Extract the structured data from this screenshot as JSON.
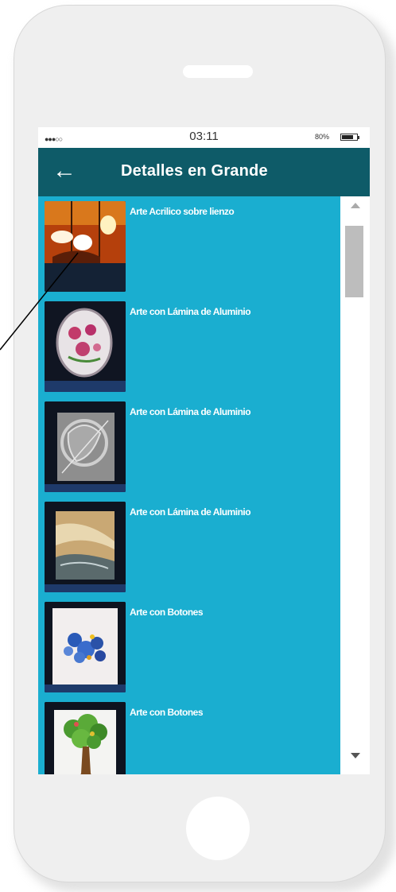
{
  "status_bar": {
    "signal": "●●●○○",
    "time": "03:11",
    "battery_percent": "80%",
    "battery_level": 0.8
  },
  "app_bar": {
    "back_icon": "arrow-left-icon",
    "title": "Detalles en Grande"
  },
  "items": [
    {
      "label": "Arte Acrilico sobre lienzo",
      "image": "painting-flowers"
    },
    {
      "label": "Arte con Lámina de Aluminio",
      "image": "aluminum-oval-flowers"
    },
    {
      "label": "Arte con Lámina de Aluminio",
      "image": "aluminum-silver-relief"
    },
    {
      "label": "Arte con Lámina de Aluminio",
      "image": "aluminum-gold-landscape"
    },
    {
      "label": "Arte con Botones",
      "image": "buttons-cat"
    },
    {
      "label": "Arte con Botones",
      "image": "buttons-tree"
    }
  ],
  "colors": {
    "app_bar": "#0e5b68",
    "list_background": "#1aaed0",
    "text": "#ffffff"
  }
}
